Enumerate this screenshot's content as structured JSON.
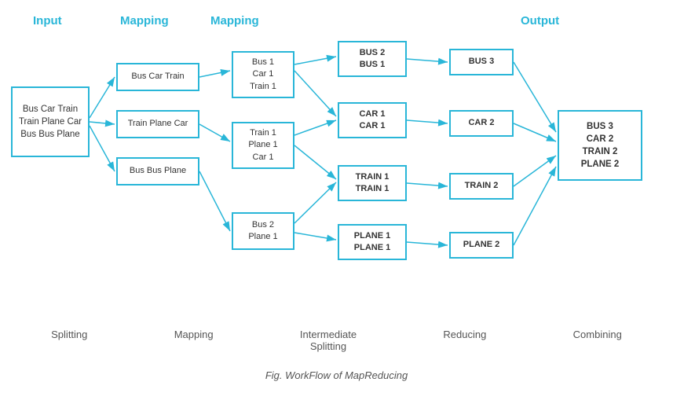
{
  "labels": {
    "input": "Input",
    "output": "Output",
    "splitting": "Splitting",
    "mapping": "Mapping",
    "intermediate_splitting": "Intermediate\nSplitting",
    "reducing": "Reducing",
    "combining": "Combining",
    "caption": "Fig. WorkFlow of MapReducing"
  },
  "boxes": {
    "input": "Bus Car Train\nTrain Plane Car\nBus Bus Plane",
    "split1": "Bus Car Train",
    "split2": "Train Plane Car",
    "split3": "Bus Bus Plane",
    "map1": "Bus 1\nCar 1\nTrain 1",
    "map2": "Train 1\nPlane 1\nCar 1",
    "map3": "Bus 2\nPlane 1",
    "inter1": "BUS 2\nBUS 1",
    "inter2": "CAR 1\nCAR 1",
    "inter3": "TRAIN 1\nTRAIN 1",
    "inter4": "PLANE 1\nPLANE 1",
    "reduce1": "BUS 3",
    "reduce2": "CAR 2",
    "reduce3": "TRAIN 2",
    "reduce4": "PLANE 2",
    "output": "BUS 3\nCAR 2\nTRAIN 2\nPLANE 2"
  },
  "colors": {
    "accent": "#29b6d8",
    "text": "#333",
    "label": "#555"
  }
}
